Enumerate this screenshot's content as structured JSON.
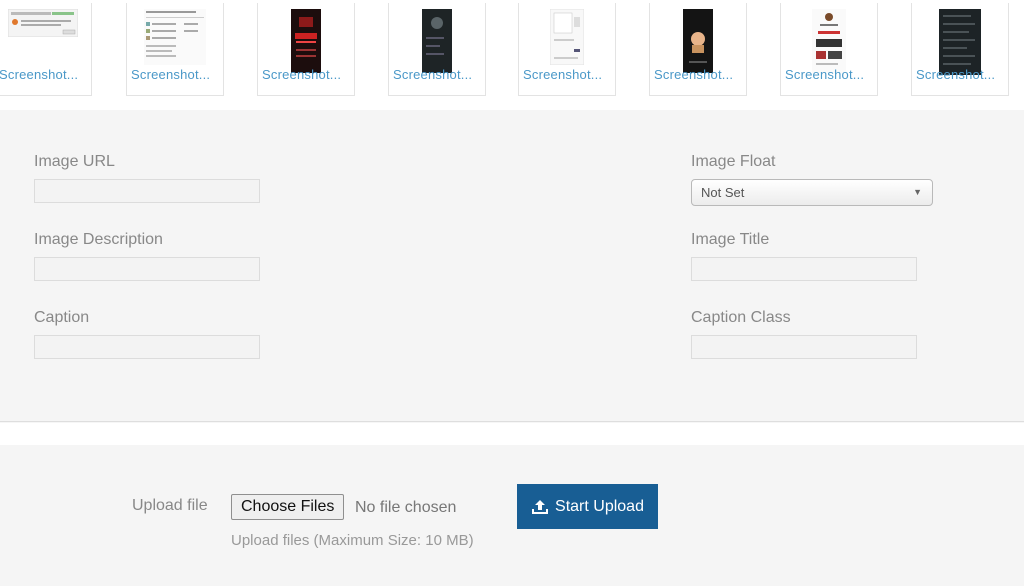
{
  "thumbnails": [
    {
      "label": "Screenshot...",
      "kind": "light-dialog"
    },
    {
      "label": "Screenshot...",
      "kind": "light-doc"
    },
    {
      "label": "Screenshot...",
      "kind": "dark-red-phone"
    },
    {
      "label": "Screenshot...",
      "kind": "dark-phone-globe"
    },
    {
      "label": "Screenshot...",
      "kind": "light-phone"
    },
    {
      "label": "Screenshot...",
      "kind": "dark-phone-face"
    },
    {
      "label": "Screenshot...",
      "kind": "light-profile"
    },
    {
      "label": "Screenshot...",
      "kind": "dark-list-phone"
    }
  ],
  "form": {
    "image_url": {
      "label": "Image URL",
      "value": ""
    },
    "image_description": {
      "label": "Image Description",
      "value": ""
    },
    "caption": {
      "label": "Caption",
      "value": ""
    },
    "image_float": {
      "label": "Image Float",
      "selected": "Not Set"
    },
    "image_title": {
      "label": "Image Title",
      "value": ""
    },
    "caption_class": {
      "label": "Caption Class",
      "value": ""
    }
  },
  "upload": {
    "label": "Upload file",
    "choose_button": "Choose Files",
    "no_file_text": "No file chosen",
    "hint": "Upload files (Maximum Size: 10 MB)",
    "start_button": "Start Upload",
    "start_icon": "upload-icon"
  },
  "colors": {
    "link": "#4a98c8",
    "primary_button": "#185e94"
  }
}
